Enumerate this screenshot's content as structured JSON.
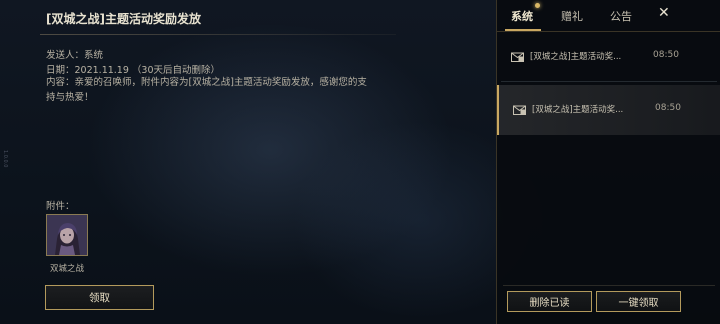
{
  "mail": {
    "title": "[双城之战]主题活动奖励发放",
    "sender": "发送人：系统",
    "date": "日期：2021.11.19 （30天后自动删除）",
    "content": "内容：亲爱的召唤师，附件内容为[双城之战]主题活动奖励发放，感谢您的支持与热爱！",
    "attachments_label": "附件：",
    "attachment": {
      "name": "双城之战",
      "icon": "champion-portrait-icon"
    },
    "claim_label": "领取"
  },
  "tabs": [
    {
      "label": "系统",
      "active": true,
      "has_notification": true
    },
    {
      "label": "赠礼",
      "active": false
    },
    {
      "label": "公告",
      "active": false
    }
  ],
  "close_label": "✕",
  "mail_list": [
    {
      "title": "[双城之战]主题活动奖...",
      "time": "08:50",
      "selected": false,
      "icon": "mail-gift-icon"
    },
    {
      "title": "[双城之战]主题活动奖...",
      "time": "08:50",
      "selected": true,
      "icon": "mail-gift-icon"
    }
  ],
  "actions": {
    "delete_read_label": "删除已读",
    "claim_all_label": "一键领取"
  },
  "side_text": "1.0.0.0",
  "colors": {
    "accent_gold": "#c9a862",
    "border_gold": "#b39a5c",
    "background": "#0b1119"
  }
}
